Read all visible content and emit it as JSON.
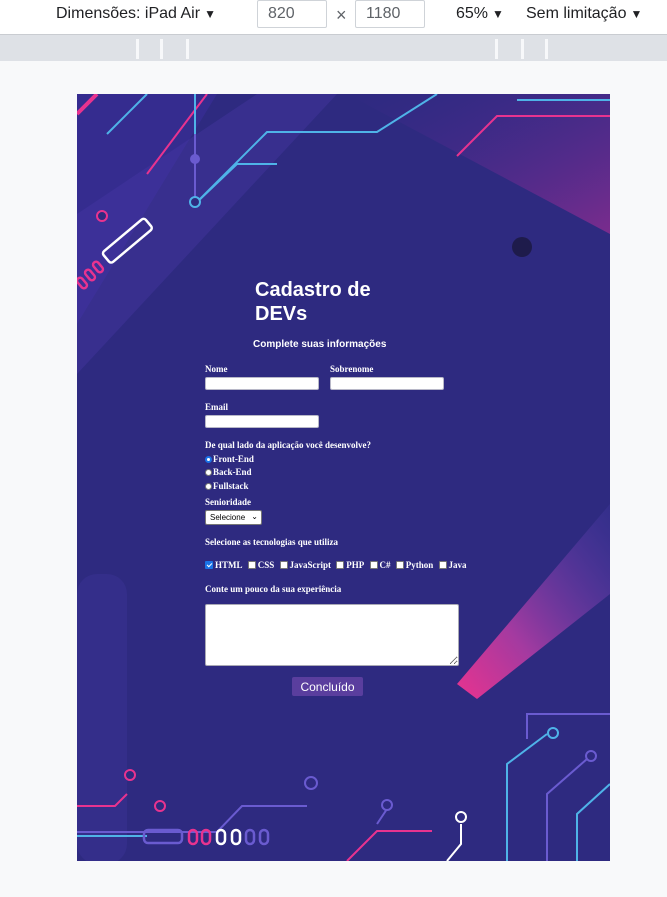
{
  "devtools": {
    "dimensions_label": "Dimensões: iPad Air",
    "width_value": "820",
    "height_value": "1180",
    "times_symbol": "×",
    "zoom_label": "65%",
    "throttle_label": "Sem limitação",
    "caret": "▼"
  },
  "form": {
    "title": "Cadastro de DEVs",
    "subtitle": "Complete suas informações",
    "first_name_label": "Nome",
    "last_name_label": "Sobrenome",
    "email_label": "Email",
    "side_question": "De qual lado da aplicação você desenvolve?",
    "sides": [
      "Front-End",
      "Back-End",
      "Fullstack"
    ],
    "selected_side": "Front-End",
    "seniority_label": "Senioridade",
    "seniority_value": "Selecione",
    "tech_question": "Selecione as tecnologias que utiliza",
    "technologies": [
      {
        "label": "HTML",
        "checked": true
      },
      {
        "label": "CSS",
        "checked": false
      },
      {
        "label": "JavaScript",
        "checked": false
      },
      {
        "label": "PHP",
        "checked": false
      },
      {
        "label": "C#",
        "checked": false
      },
      {
        "label": "Python",
        "checked": false
      },
      {
        "label": "Java",
        "checked": false
      }
    ],
    "experience_label": "Conte um pouco da sua experiência",
    "submit_label": "Concluído"
  },
  "colors": {
    "accent_pink": "#e8338f",
    "accent_cyan": "#4fb3e8",
    "button": "#5a3e9e"
  }
}
